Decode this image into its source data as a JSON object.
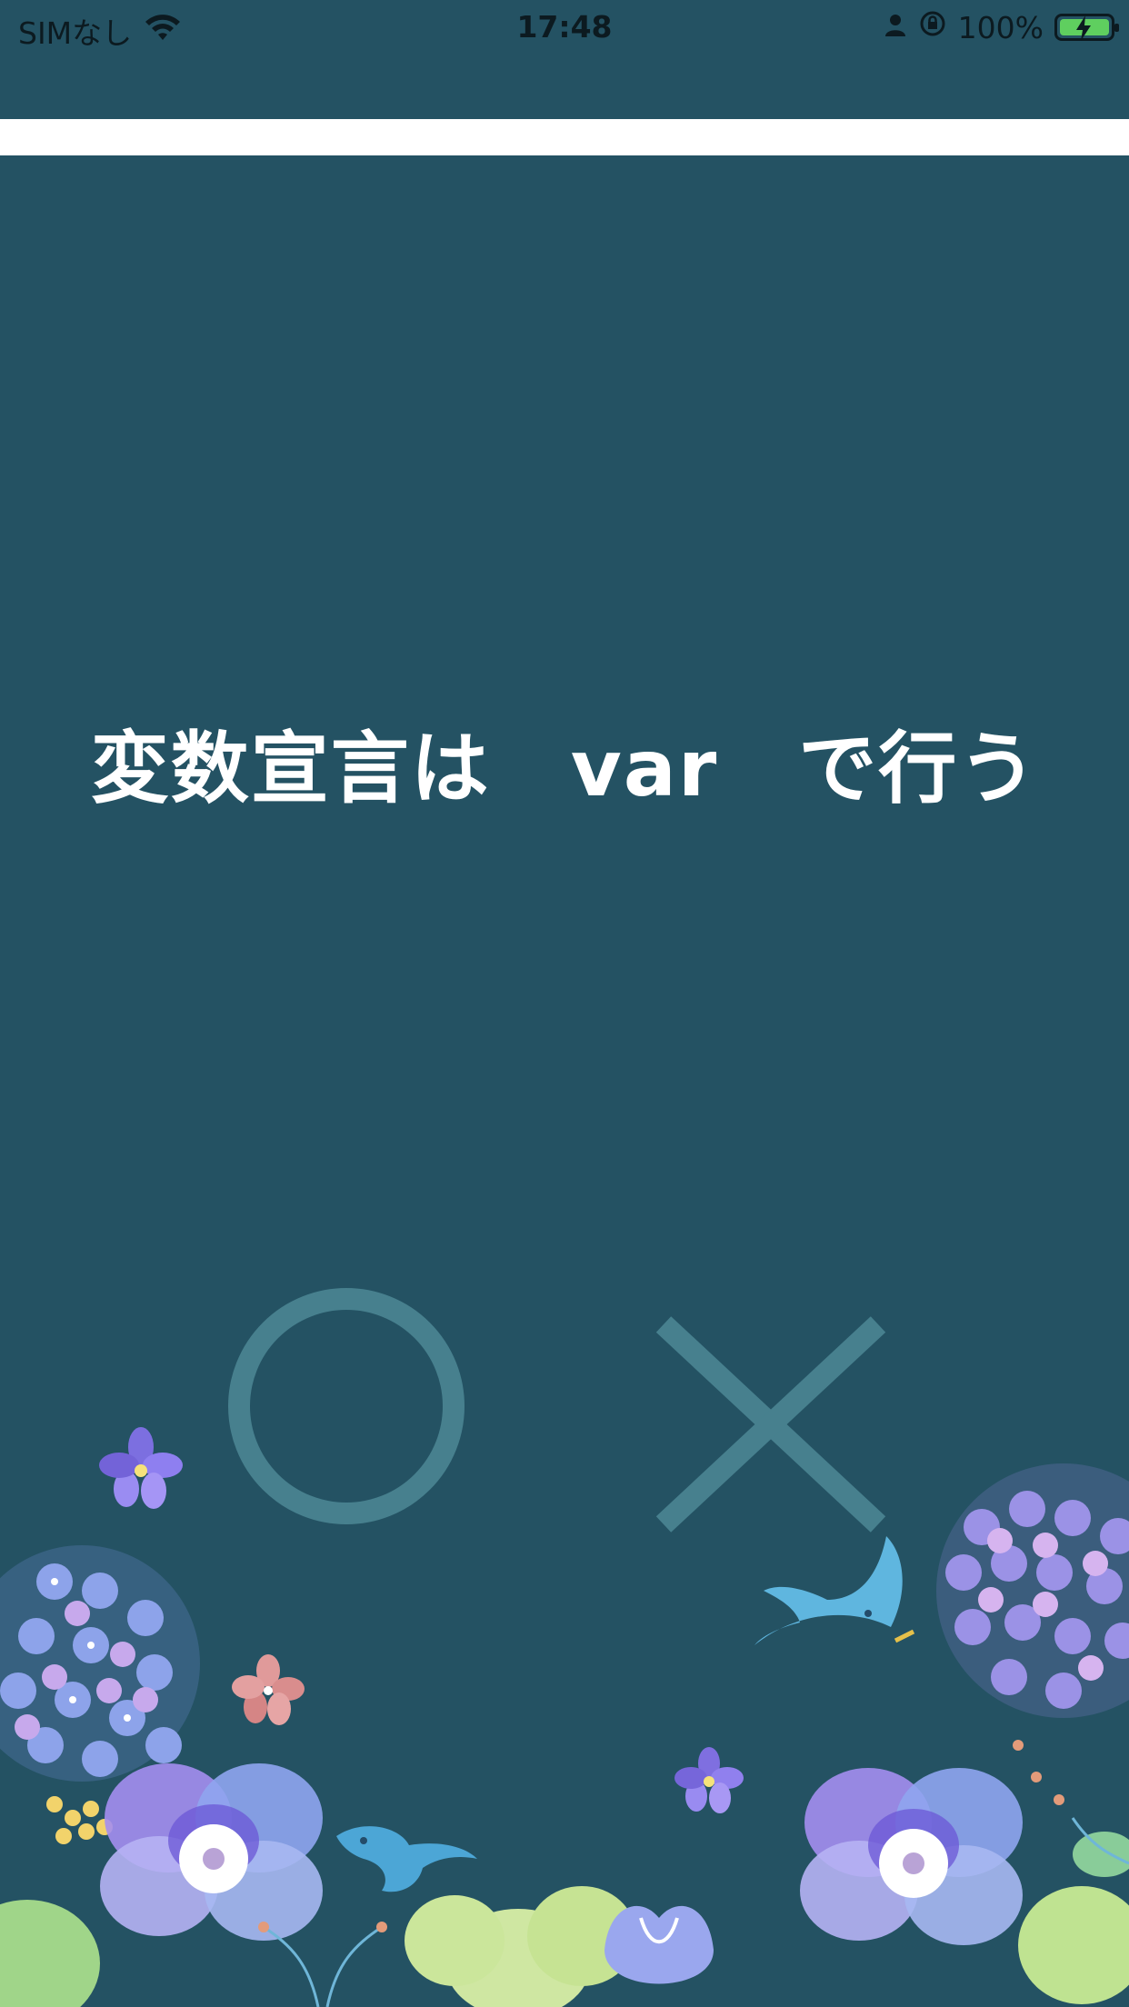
{
  "status_bar": {
    "carrier": "SIMなし",
    "time": "17:48",
    "battery_percent": "100%"
  },
  "quiz": {
    "progress": 0.0,
    "question": "変数宣言は　var　で行う",
    "buttons": [
      {
        "name": "circle-answer-button",
        "icon": "circle-icon",
        "meaning": "true"
      },
      {
        "name": "cross-answer-button",
        "icon": "cross-icon",
        "meaning": "false"
      }
    ]
  },
  "colors": {
    "background": "#245263",
    "answer_mark": "#47808E",
    "text": "#FFFFFF",
    "progress_track": "#FFFFFF"
  }
}
